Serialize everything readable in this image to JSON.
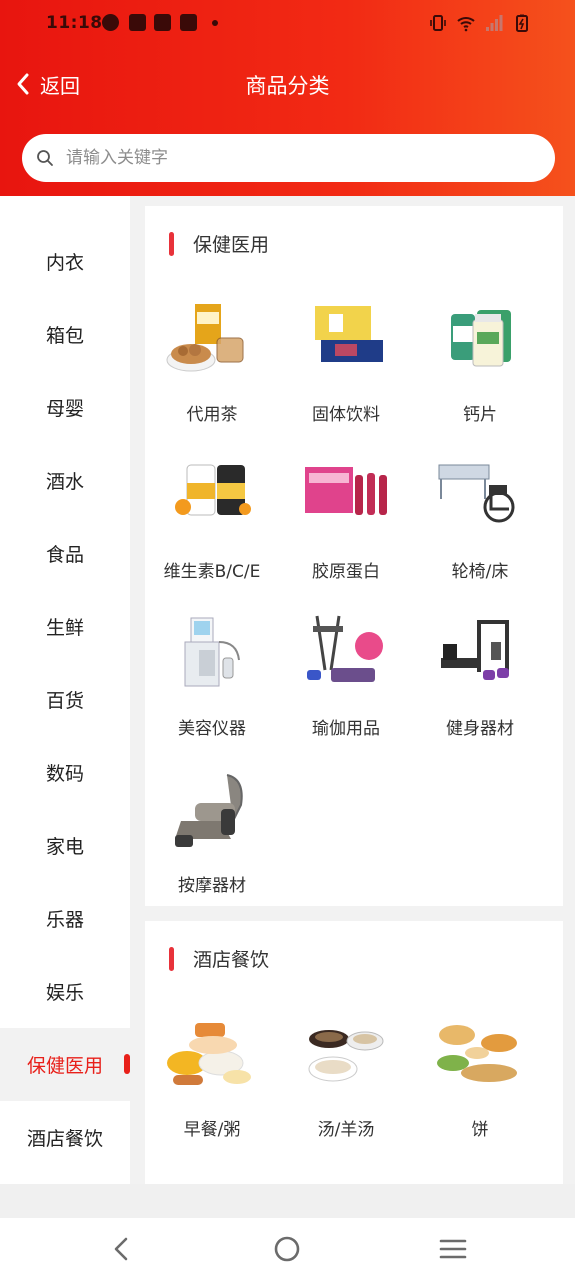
{
  "status_bar": {
    "time": "11:18"
  },
  "nav": {
    "back_label": "返回",
    "title": "商品分类"
  },
  "search": {
    "placeholder": "请输入关键字"
  },
  "sidebar": {
    "items": [
      {
        "label": "内衣"
      },
      {
        "label": "箱包"
      },
      {
        "label": "母婴"
      },
      {
        "label": "酒水"
      },
      {
        "label": "食品"
      },
      {
        "label": "生鲜"
      },
      {
        "label": "百货"
      },
      {
        "label": "数码"
      },
      {
        "label": "家电"
      },
      {
        "label": "乐器"
      },
      {
        "label": "娱乐"
      },
      {
        "label": "保健医用"
      },
      {
        "label": "酒店餐饮"
      }
    ],
    "active_label": "保健医用"
  },
  "sections": [
    {
      "title": "保健医用",
      "items": [
        {
          "label": "代用茶",
          "icon": "herbal-tea-icon"
        },
        {
          "label": "固体饮料",
          "icon": "solid-drink-box-icon"
        },
        {
          "label": "钙片",
          "icon": "calcium-bottle-icon"
        },
        {
          "label": "维生素B/C/E",
          "icon": "vitamin-bottle-icon"
        },
        {
          "label": "胶原蛋白",
          "icon": "collagen-drink-icon"
        },
        {
          "label": "轮椅/床",
          "icon": "wheelchair-icon"
        },
        {
          "label": "美容仪器",
          "icon": "beauty-device-icon"
        },
        {
          "label": "瑜伽用品",
          "icon": "yoga-gear-icon"
        },
        {
          "label": "健身器材",
          "icon": "fitness-machine-icon"
        },
        {
          "label": "按摩器材",
          "icon": "massage-chair-icon"
        }
      ]
    },
    {
      "title": "酒店餐饮",
      "items": [
        {
          "label": "早餐/粥",
          "icon": "breakfast-icon"
        },
        {
          "label": "汤/羊汤",
          "icon": "soup-icon"
        },
        {
          "label": "饼",
          "icon": "flatbread-icon"
        }
      ]
    }
  ],
  "colors": {
    "accent": "#e8201a",
    "header_start": "#e8150f",
    "header_end": "#f5511c"
  }
}
